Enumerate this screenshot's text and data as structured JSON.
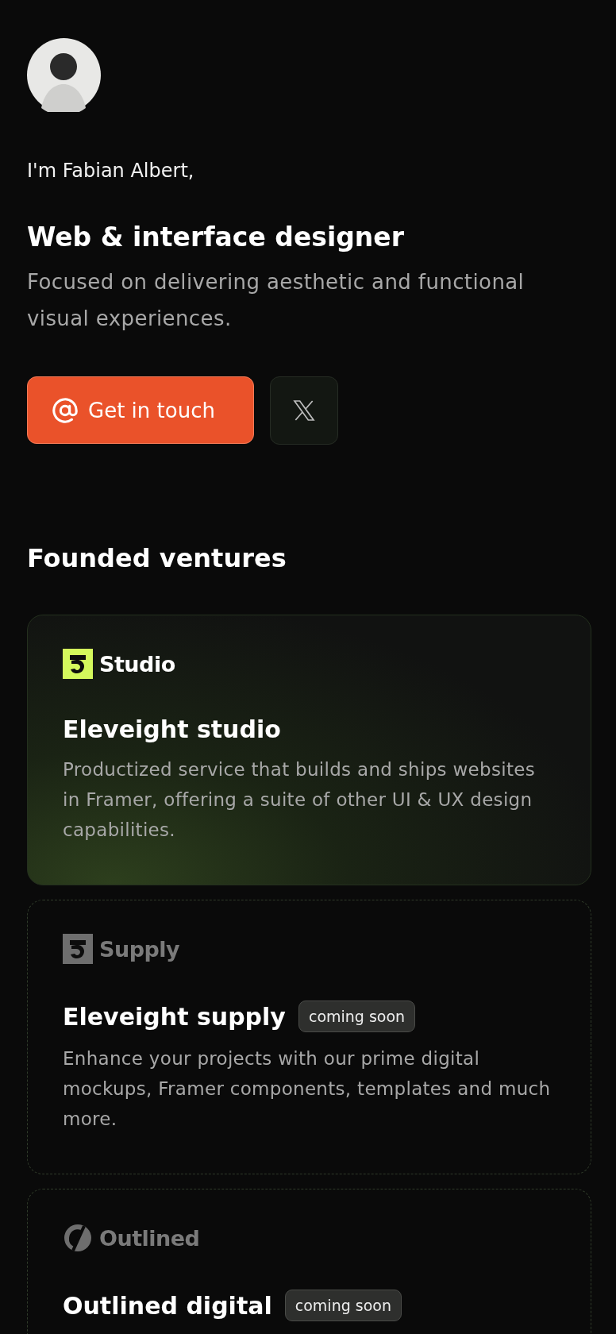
{
  "profile": {
    "intro": "I'm Fabian Albert,",
    "headline": "Web & interface designer",
    "tagline": "Focused on delivering aesthetic and functional visual experiences."
  },
  "actions": {
    "contact": "Get in touch"
  },
  "ventures_heading": "Founded ventures",
  "ventures": [
    {
      "kind": "featured",
      "logo": {
        "kind": "eleveight",
        "label": "Studio"
      },
      "title": "Eleveight studio",
      "description": "Productized service that builds and ships websites in Framer, offering a suite of other UI & UX design capabilities."
    },
    {
      "kind": "upcoming",
      "logo": {
        "kind": "eleveight",
        "label": "Supply"
      },
      "title": "Eleveight supply",
      "badge": "coming soon",
      "description": "Enhance your projects with our prime digital mockups, Framer components, templates and much more."
    },
    {
      "kind": "upcoming",
      "logo": {
        "kind": "outlined",
        "label": "Outlined"
      },
      "title": "Outlined digital",
      "badge": "coming soon"
    }
  ]
}
